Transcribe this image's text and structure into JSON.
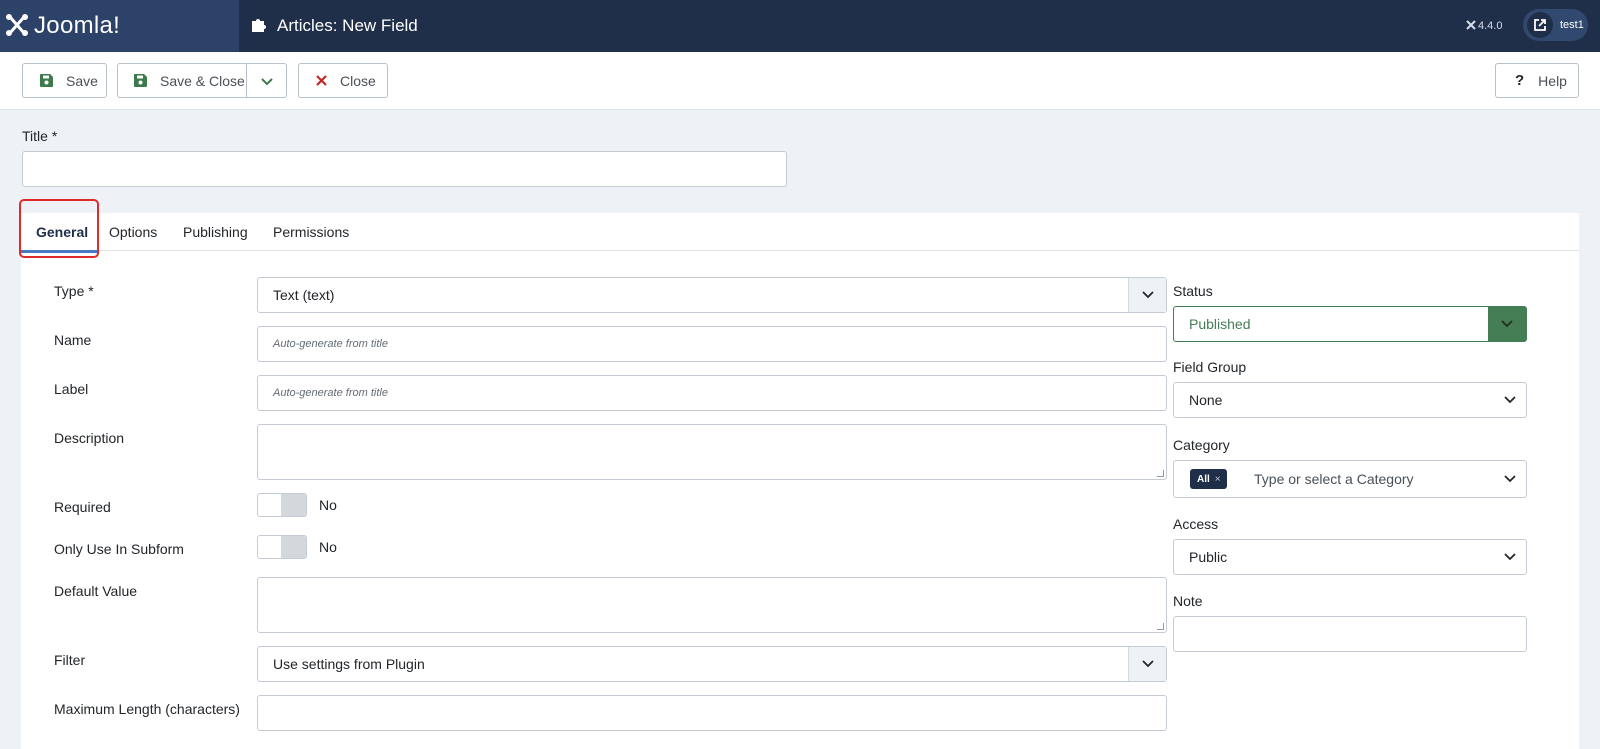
{
  "header": {
    "brand": "Joomla!",
    "page_title": "Articles: New Field",
    "version": "4.4.0",
    "user": "test1"
  },
  "toolbar": {
    "save": "Save",
    "save_close": "Save & Close",
    "close": "Close",
    "help": "Help"
  },
  "form": {
    "title_label": "Title *",
    "title_value": ""
  },
  "tabs": [
    {
      "label": "General",
      "active": true
    },
    {
      "label": "Options",
      "active": false
    },
    {
      "label": "Publishing",
      "active": false
    },
    {
      "label": "Permissions",
      "active": false
    }
  ],
  "general": {
    "type": {
      "label": "Type *",
      "value": "Text (text)"
    },
    "name": {
      "label": "Name",
      "placeholder": "Auto-generate from title"
    },
    "label": {
      "label": "Label",
      "placeholder": "Auto-generate from title"
    },
    "description": {
      "label": "Description",
      "value": ""
    },
    "required": {
      "label": "Required",
      "value": "No"
    },
    "only_subform": {
      "label": "Only Use In Subform",
      "value": "No"
    },
    "default_value": {
      "label": "Default Value",
      "value": ""
    },
    "filter": {
      "label": "Filter",
      "value": "Use settings from Plugin"
    },
    "max_length": {
      "label": "Maximum Length (characters)",
      "value": ""
    }
  },
  "sidebar": {
    "status": {
      "label": "Status",
      "value": "Published"
    },
    "field_group": {
      "label": "Field Group",
      "value": "None"
    },
    "category": {
      "label": "Category",
      "chip": "All",
      "chip_remove": "×",
      "placeholder": "Type or select a Category"
    },
    "access": {
      "label": "Access",
      "value": "Public"
    },
    "note": {
      "label": "Note",
      "value": ""
    }
  },
  "colors": {
    "header_bg": "#1f2e49",
    "logo_bg": "#2c4269",
    "status_green": "#457d54",
    "tab_underline": "#4b78c2",
    "highlight_red": "#e02a2a"
  }
}
